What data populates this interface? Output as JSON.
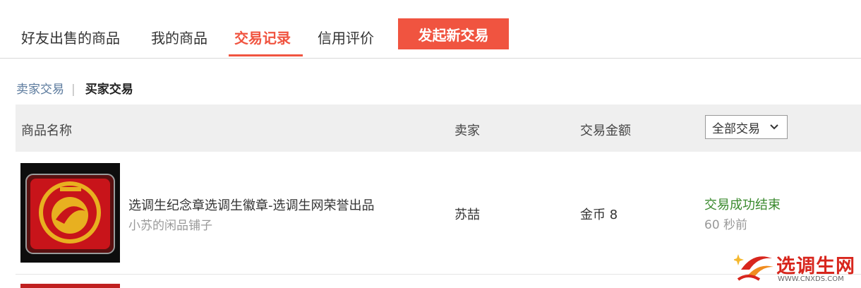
{
  "tabs": [
    {
      "label": "好友出售的商品"
    },
    {
      "label": "我的商品"
    },
    {
      "label": "交易记录",
      "active": true
    },
    {
      "label": "信用评价"
    }
  ],
  "new_trade_button": "发起新交易",
  "subtabs": {
    "seller": "卖家交易",
    "separator": "|",
    "buyer": "买家交易",
    "active": "buyer"
  },
  "table": {
    "headers": {
      "name": "商品名称",
      "seller": "卖家",
      "amount": "交易金额"
    },
    "filter": {
      "selected": "全部交易",
      "icon": "chevron-down-icon"
    },
    "rows": [
      {
        "product": "选调生纪念章选调生徽章-选调生网荣誉出品",
        "shop": "小苏的闲品铺子",
        "seller": "苏喆",
        "amount": "金币 8",
        "status": "交易成功结束",
        "time": "60 秒前"
      }
    ]
  },
  "watermark": {
    "name": "选调生网",
    "url": "WWW.CNXDS.COM"
  },
  "colors": {
    "accent": "#f05440",
    "success": "#3a8a2e",
    "muted": "#999999",
    "header_bg": "#efefef",
    "watermark": "#d8261d"
  }
}
